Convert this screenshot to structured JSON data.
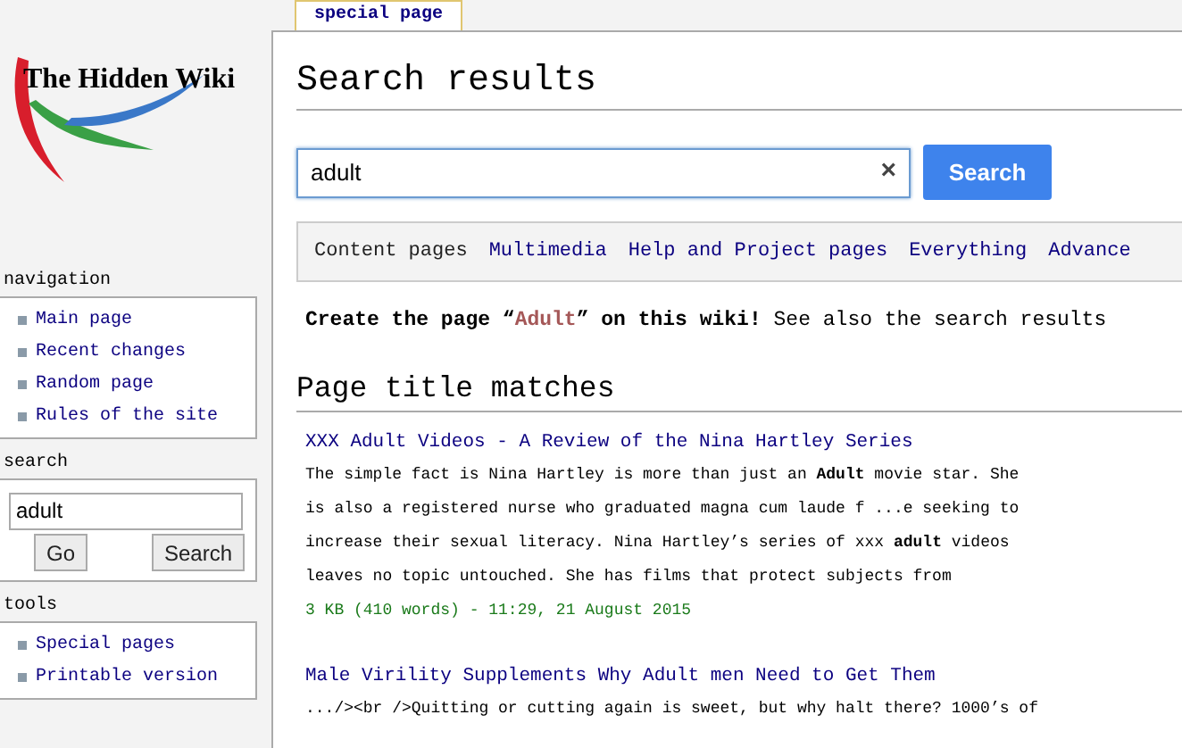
{
  "logo": {
    "text": "The Hidden Wiki"
  },
  "tab": {
    "label": "special page",
    "selected": true
  },
  "sidebar": {
    "sections": [
      {
        "kind": "links",
        "heading": "navigation",
        "items": [
          "Main page",
          "Recent changes",
          "Random page",
          "Rules of the site"
        ]
      },
      {
        "kind": "search",
        "heading": "search",
        "value": "adult",
        "buttons": [
          "Go",
          "Search"
        ]
      },
      {
        "kind": "links",
        "heading": "tools",
        "items": [
          "Special pages",
          "Printable version"
        ]
      }
    ]
  },
  "page_title": "Search results",
  "search": {
    "value": "adult",
    "clear": "×",
    "button": "Search"
  },
  "filters": [
    "Content pages",
    "Multimedia",
    "Help and Project pages",
    "Everything",
    "Advance"
  ],
  "create_notice": {
    "before": "Create the page “",
    "link": "Adult",
    "after": "” on this wiki!",
    "rest": "See also the search results"
  },
  "section_heading": "Page title matches",
  "results": [
    {
      "title": "XXX Adult Videos - A Review of the Nina Hartley Series",
      "snippet": "The simple fact is Nina Hartley is more than just an **Adult** movie star. She is also a registered nurse who graduated magna cum laude f ...e seeking to increase their sexual literacy. Nina Hartley’s series of xxx **adult** videos leaves no topic untouched. She has films that protect subjects from",
      "meta": "3 KB (410 words) - 11:29, 21 August 2015"
    },
    {
      "title": "Male Virility Supplements Why Adult men Need to Get Them",
      "snippet": ".../><br />Quitting or cutting again is sweet, but why halt there? 1000’s of"
    }
  ]
}
